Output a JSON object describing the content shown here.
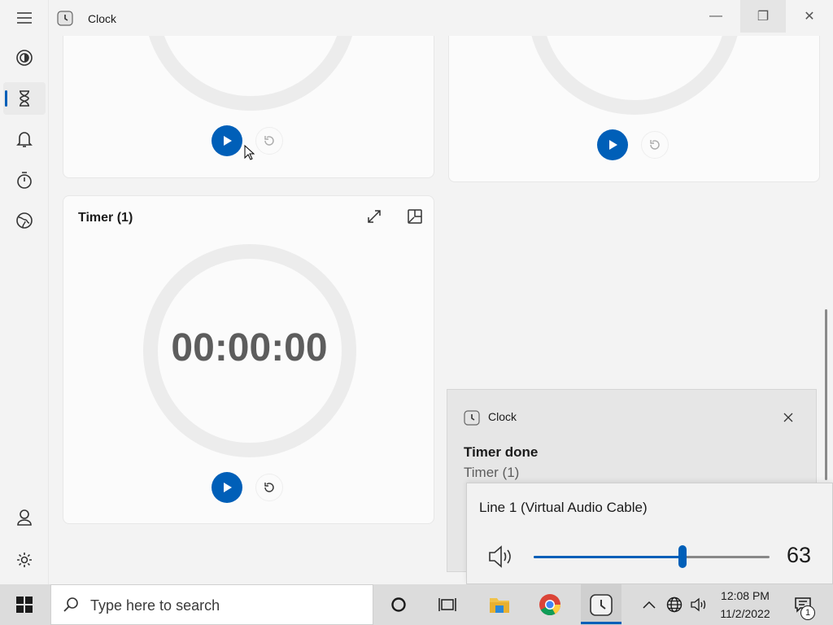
{
  "app": {
    "title": "Clock"
  },
  "window_controls": {
    "minimize": "—",
    "maximize": "❐",
    "close": "✕"
  },
  "nav": {
    "items": [
      {
        "name": "focus-sessions",
        "icon": "focus-icon"
      },
      {
        "name": "timer",
        "icon": "hourglass-icon",
        "active": true
      },
      {
        "name": "alarm",
        "icon": "bell-icon"
      },
      {
        "name": "stopwatch",
        "icon": "stopwatch-icon"
      },
      {
        "name": "world-clock",
        "icon": "globe-icon"
      }
    ],
    "bottom": [
      {
        "name": "account",
        "icon": "person-icon"
      },
      {
        "name": "settings",
        "icon": "gear-icon"
      }
    ]
  },
  "timers": [
    {
      "title": "Timer (1)",
      "time": "00:00:00"
    }
  ],
  "toast": {
    "app_name": "Clock",
    "title": "Timer done",
    "body": "Timer (1)"
  },
  "volume": {
    "device": "Line 1 (Virtual Audio Cable)",
    "level": 63,
    "level_label": "63"
  },
  "taskbar": {
    "search_placeholder": "Type here to search",
    "time": "12:08 PM",
    "date": "11/2/2022",
    "notification_count": "1"
  },
  "colors": {
    "accent": "#005fb8",
    "ring": "#ececec",
    "card": "#fbfbfb",
    "background": "#f3f3f3"
  }
}
